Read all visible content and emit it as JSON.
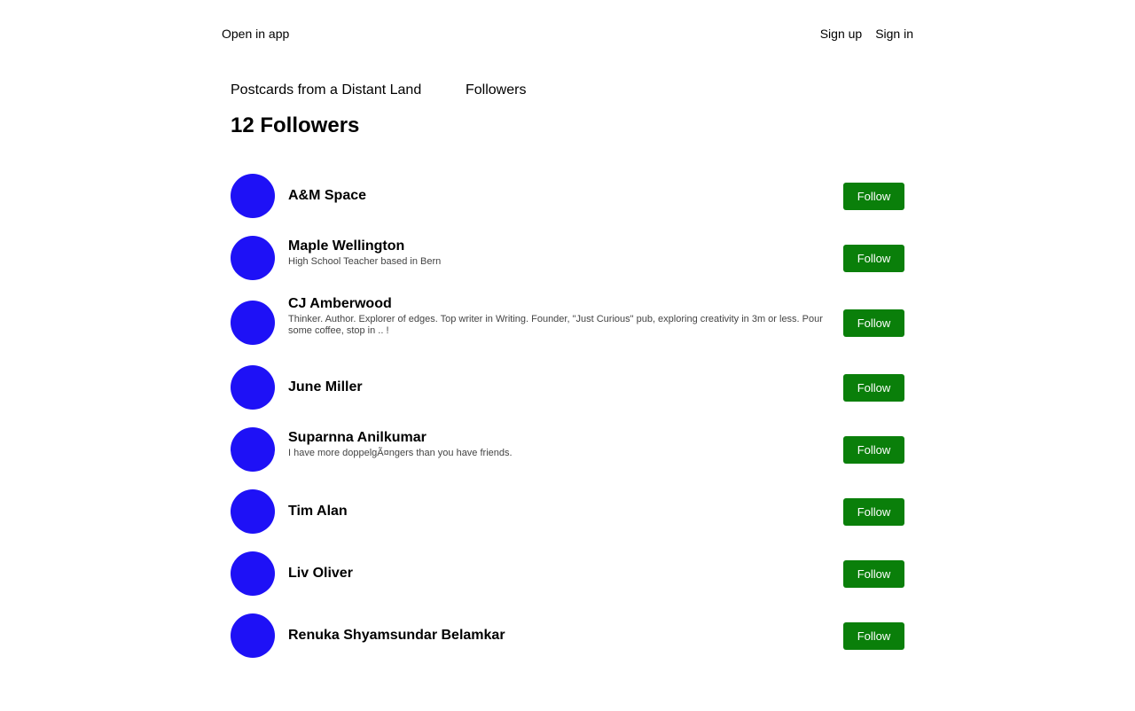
{
  "topbar": {
    "open_in_app": "Open in app",
    "sign_up": "Sign up",
    "sign_in": "Sign in"
  },
  "breadcrumb": {
    "publication": "Postcards from a Distant Land",
    "section": "Followers"
  },
  "page_title": "12 Followers",
  "colors": {
    "avatar": "#1e11f6",
    "follow_button": "#0a7f0a"
  },
  "followers": [
    {
      "name": "A&M Space",
      "bio": "",
      "button": "Follow"
    },
    {
      "name": "Maple Wellington",
      "bio": "High School Teacher based in Bern",
      "button": "Follow"
    },
    {
      "name": "CJ Amberwood",
      "bio": "Thinker. Author. Explorer of edges. Top writer in Writing. Founder, \"Just Curious\" pub, exploring creativity in 3m or less. Pour some coffee, stop in .. !",
      "button": "Follow"
    },
    {
      "name": "June Miller",
      "bio": "",
      "button": "Follow"
    },
    {
      "name": "Suparnna Anilkumar",
      "bio": "I have more doppelgÃ¤ngers than you have friends.",
      "button": "Follow"
    },
    {
      "name": "Tim Alan",
      "bio": "",
      "button": "Follow"
    },
    {
      "name": "Liv Oliver",
      "bio": "",
      "button": "Follow"
    },
    {
      "name": "Renuka Shyamsundar Belamkar",
      "bio": "",
      "button": "Follow"
    }
  ]
}
